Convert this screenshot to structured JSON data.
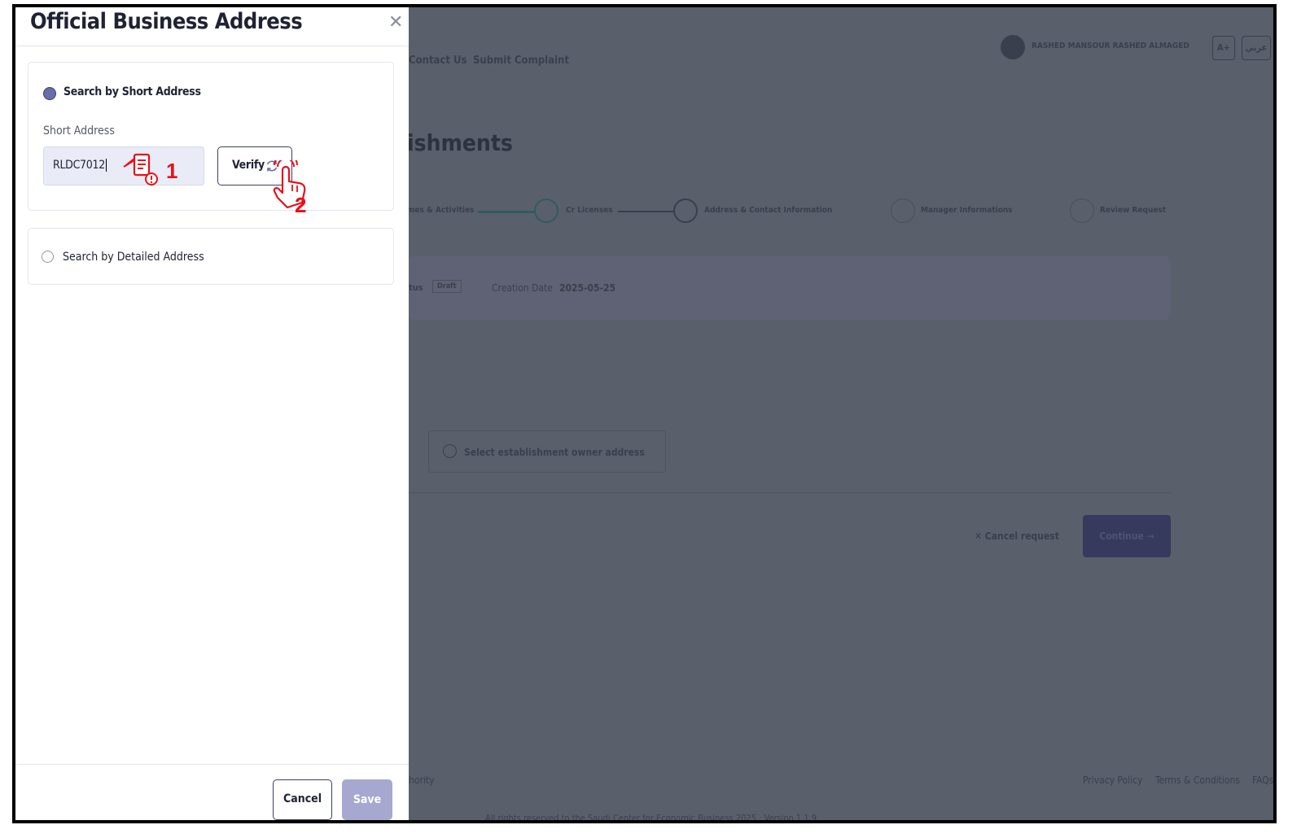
{
  "background_page": {
    "nav": [
      "Contact Us",
      "Submit Complaint"
    ],
    "user_name": "RASHED MANSOUR RASHED ALMAGED",
    "header_buttons": [
      "A+",
      "عربي"
    ],
    "heading_fragment": "ishments",
    "steps": [
      "mes & Activities",
      "Cr Licenses",
      "Address & Contact Information",
      "Manager Informations",
      "Review Request"
    ],
    "status_label": "tus",
    "status_badge": "Draft",
    "creation_label": "Creation Date",
    "creation_date": "2025-05-25",
    "owner_option": "Select establishment owner address",
    "cancel_request": "✕ Cancel request",
    "continue_label": "Continue →",
    "footer_left": "hority",
    "footer_links": [
      "Privacy Policy",
      "Terms & Conditions",
      "FAQs"
    ],
    "copyright": "All rights reserved to the Saudi Center for Economic Business 2025 · Version 1.1.9"
  },
  "drawer": {
    "title": "Official Business Address",
    "close": "✕",
    "option_short": "Search by Short Address",
    "short_address_label": "Short Address",
    "short_address_value": "RLDC7012",
    "verify_label": "Verify",
    "option_detailed": "Search by Detailed Address",
    "cancel_label": "Cancel",
    "save_label": "Save"
  },
  "annotations": {
    "step1": "1",
    "step2": "2"
  },
  "colors": {
    "accent": "#3b3d6b",
    "overlay": "#5a5f6c",
    "annotation_red": "#e8101a"
  }
}
